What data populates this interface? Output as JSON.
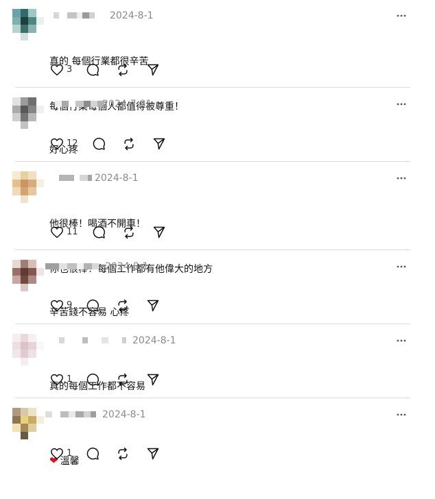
{
  "comments": [
    {
      "date": "2024-8-1",
      "lines": [
        "真的 每個行業都很辛苦",
        "每個行業每個人都值得被尊重！"
      ],
      "likes": "3"
    },
    {
      "date": "2024-7-31",
      "lines": [
        "好心疼"
      ],
      "likes": "12"
    },
    {
      "date": "2024-8-1",
      "lines": [
        "他很棒！喝酒不開車！",
        "你也很棒！每個工作都有他偉大的地方"
      ],
      "likes": "11"
    },
    {
      "date": "2024-8-1",
      "lines": [
        "辛苦錢不容易 心疼"
      ],
      "likes": "9"
    },
    {
      "date": "2024-8-1",
      "lines": [
        "真的每個工作都不容易"
      ],
      "likes": "1"
    },
    {
      "date": "2024-8-1",
      "emoji": "❤",
      "lines": [
        "溫馨"
      ],
      "likes": "1"
    }
  ],
  "icons": {
    "like": "heart-outline-icon",
    "reply": "speech-bubble-icon",
    "repost": "repost-icon",
    "share": "send-icon",
    "more": "more-dots-icon"
  },
  "colors": {
    "date": "#8a8a8a",
    "separator": "#dcdcdc",
    "heart": "#d6121a"
  }
}
